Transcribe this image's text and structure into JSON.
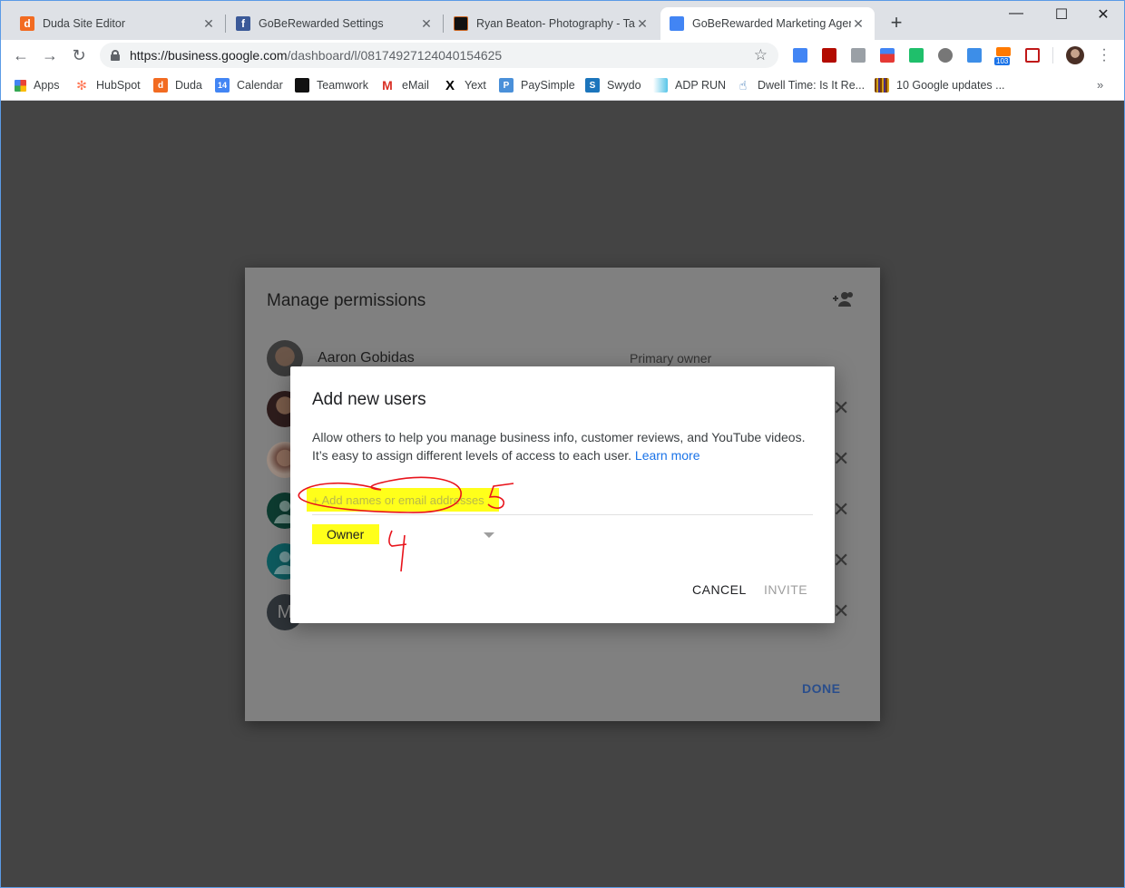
{
  "browser": {
    "tabs": [
      {
        "title": "Duda Site Editor",
        "favicon": "duda-icon",
        "color": "#f26b21",
        "glyph": "d",
        "active": false
      },
      {
        "title": "GoBeRewarded Settings",
        "favicon": "facebook-icon",
        "color": "#3b5998",
        "glyph": "f",
        "active": false
      },
      {
        "title": "Ryan Beaton- Photography - Task",
        "favicon": "teamwork-icon",
        "color": "#111111",
        "glyph": "",
        "active": false
      },
      {
        "title": "GoBeRewarded Marketing Agenc",
        "favicon": "google-my-business-icon",
        "color": "#4285f4",
        "glyph": "",
        "active": true
      }
    ],
    "new_tab": "+",
    "window_controls": {
      "minimize": "—",
      "maximize": "☐",
      "close": "✕"
    },
    "nav": {
      "back": "←",
      "forward": "→",
      "reload": "↻"
    },
    "url": {
      "host": "https://business.google.com",
      "path": "/dashboard/l/08174927124040154625"
    },
    "star": "☆",
    "extensions": [
      {
        "name": "extension-blue-icon",
        "color": "#4285f4"
      },
      {
        "name": "adobe-acrobat-icon",
        "color": "#b30b00"
      },
      {
        "name": "code-view-icon",
        "color": "#9aa0a6"
      },
      {
        "name": "extension-red-arrow-icon",
        "color": "#e53935"
      },
      {
        "name": "extension-green-face-icon",
        "color": "#1fbf6b"
      },
      {
        "name": "film-reel-icon",
        "color": "#777777"
      },
      {
        "name": "extension-tb-icon",
        "color": "#3d8ee8"
      },
      {
        "name": "hubspot-ext-icon",
        "color": "#ff7a00",
        "badge": "103"
      },
      {
        "name": "mcafee-icon",
        "color": "#c01818"
      }
    ],
    "bookmarks": [
      {
        "label": "Apps",
        "icon": "apps-grid-icon",
        "color": "#ea4335"
      },
      {
        "label": "HubSpot",
        "icon": "hubspot-icon",
        "color": "#ff7a59"
      },
      {
        "label": "Duda",
        "icon": "duda-icon",
        "color": "#f26b21"
      },
      {
        "label": "Calendar",
        "icon": "calendar-icon",
        "color": "#4285f4",
        "glyph": "14"
      },
      {
        "label": "Teamwork",
        "icon": "teamwork-icon",
        "color": "#111111"
      },
      {
        "label": "eMail",
        "icon": "gmail-icon",
        "color": "#d93025"
      },
      {
        "label": "Yext",
        "icon": "yext-icon",
        "color": "#000000"
      },
      {
        "label": "PaySimple",
        "icon": "paysimple-icon",
        "color": "#4a90d9"
      },
      {
        "label": "Swydo",
        "icon": "swydo-icon",
        "color": "#1c75bc"
      },
      {
        "label": "ADP RUN",
        "icon": "adp-icon",
        "color": "#57c5e8"
      },
      {
        "label": "Dwell Time: Is It Re...",
        "icon": "cursor-hand-icon",
        "color": "#2b6cb0"
      },
      {
        "label": "10 Google updates ...",
        "icon": "striped-icon",
        "color": "#7b3f00"
      }
    ],
    "bookmarks_overflow": "»"
  },
  "permissions_dialog": {
    "title": "Manage permissions",
    "users": [
      {
        "name": "Aaron Gobidas",
        "role": "Primary owner",
        "avatar": "photo"
      },
      {
        "name": "",
        "role": "",
        "avatar": "photo"
      },
      {
        "name": "",
        "role": "",
        "avatar": "photo"
      },
      {
        "name": "",
        "role": "",
        "avatar": "person-dark-green"
      },
      {
        "name": "",
        "role": "",
        "avatar": "person-teal"
      },
      {
        "name": "",
        "role": "",
        "avatar": "letter",
        "letter": "M"
      }
    ],
    "remove_glyph": "✕",
    "done_label": "DONE"
  },
  "add_users_dialog": {
    "title": "Add new users",
    "description": "Allow others to help you manage business info, customer reviews, and YouTube videos. It’s easy to assign different levels of access to each user.",
    "learn_more": "Learn more",
    "input_placeholder": "+ Add names or email addresses",
    "input_value": "",
    "role_value": "Owner",
    "cancel_label": "CANCEL",
    "invite_label": "INVITE",
    "annotations": {
      "number_near_input": "5",
      "number_near_role": "4",
      "highlight_color": "#ffff1a",
      "ink_color": "#e8141c"
    }
  },
  "colors": {
    "scrim": "#444444",
    "link": "#1a73e8",
    "done": "#2a4e8c"
  }
}
